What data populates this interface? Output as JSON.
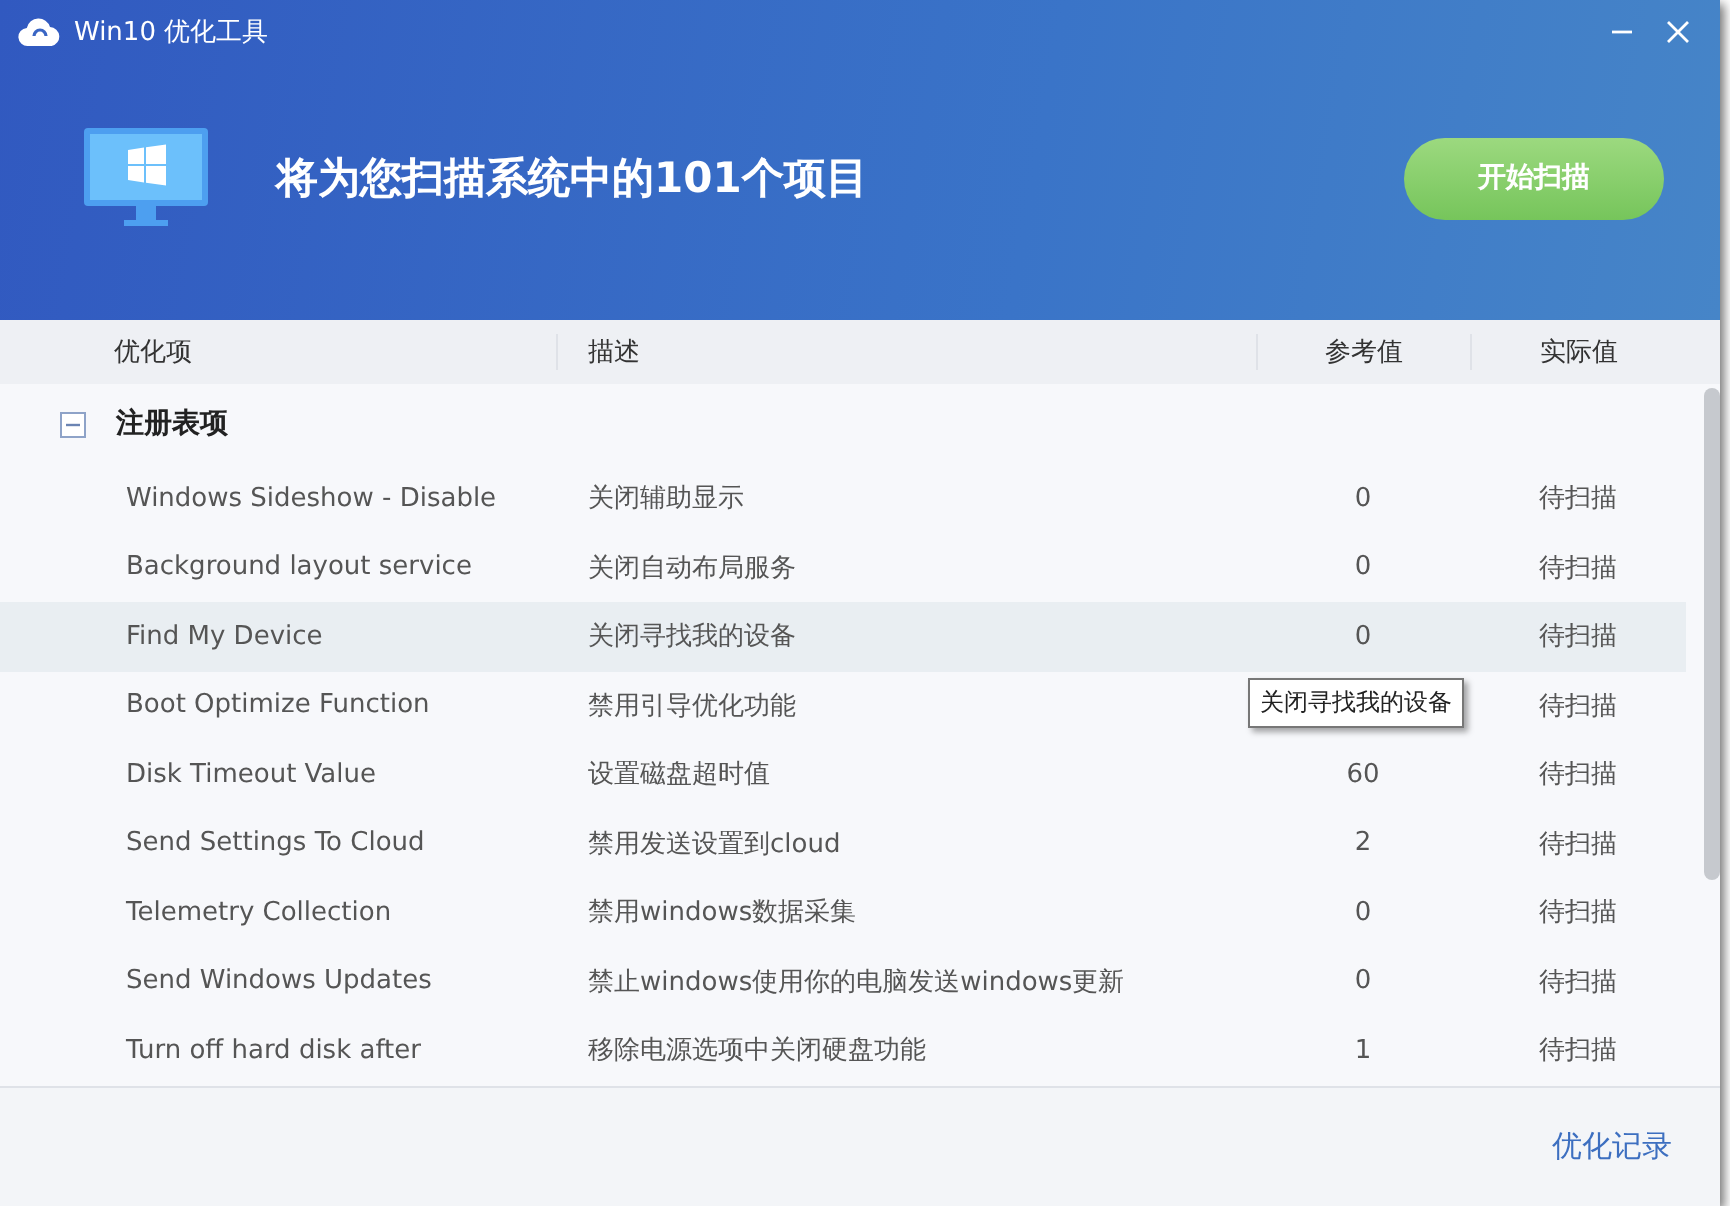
{
  "window": {
    "title": "Win10 优化工具"
  },
  "hero": {
    "message": "将为您扫描系统中的101个项目",
    "scan_button": "开始扫描"
  },
  "table": {
    "columns": [
      "优化项",
      "描述",
      "参考值",
      "实际值"
    ],
    "groups": [
      {
        "label": "注册表项",
        "expanded": true,
        "rows": [
          {
            "name": "Windows Sideshow - Disable",
            "description": "关闭辅助显示",
            "reference": "0",
            "actual": "待扫描",
            "selected": false
          },
          {
            "name": "Background layout service",
            "description": "关闭自动布局服务",
            "reference": "0",
            "actual": "待扫描",
            "selected": false
          },
          {
            "name": "Find My Device",
            "description": "关闭寻找我的设备",
            "reference": "0",
            "actual": "待扫描",
            "selected": true
          },
          {
            "name": "Boot Optimize Function",
            "description": "禁用引导优化功能",
            "actual": "待扫描",
            "selected": false
          },
          {
            "name": "Disk Timeout Value",
            "description": "设置磁盘超时值",
            "reference": "60",
            "actual": "待扫描",
            "selected": false
          },
          {
            "name": "Send Settings To Cloud",
            "description": "禁用发送设置到cloud",
            "reference": "2",
            "actual": "待扫描",
            "selected": false
          },
          {
            "name": "Telemetry Collection",
            "description": "禁用windows数据采集",
            "reference": "0",
            "actual": "待扫描",
            "selected": false
          },
          {
            "name": "Send Windows Updates",
            "description": "禁止windows使用你的电脑发送windows更新",
            "reference": "0",
            "actual": "待扫描",
            "selected": false
          },
          {
            "name": "Turn off hard disk after",
            "description": "移除电源选项中关闭硬盘功能",
            "reference": "1",
            "actual": "待扫描",
            "selected": false
          }
        ]
      }
    ]
  },
  "tooltip": {
    "text": "关闭寻找我的设备"
  },
  "footer": {
    "link": "优化记录"
  }
}
